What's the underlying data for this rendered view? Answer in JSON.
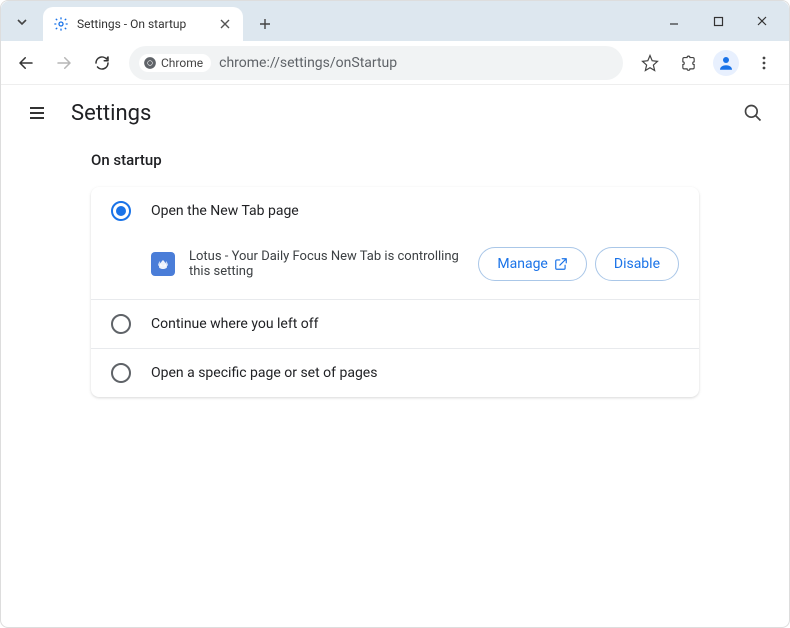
{
  "window": {
    "tab_title": "Settings - On startup"
  },
  "toolbar": {
    "chrome_chip": "Chrome",
    "url": "chrome://settings/onStartup"
  },
  "header": {
    "title": "Settings"
  },
  "section": {
    "title": "On startup",
    "options": [
      {
        "label": "Open the New Tab page",
        "selected": true
      },
      {
        "label": "Continue where you left off",
        "selected": false
      },
      {
        "label": "Open a specific page or set of pages",
        "selected": false
      }
    ],
    "extension_notice": "Lotus - Your Daily Focus New Tab is controlling this setting",
    "manage_label": "Manage",
    "disable_label": "Disable"
  }
}
